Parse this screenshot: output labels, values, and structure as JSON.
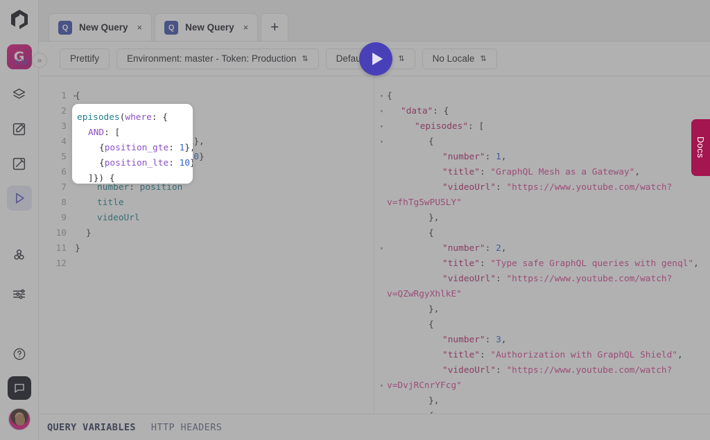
{
  "app": {
    "brand_logo_name": "hygraph-logo",
    "project_initial": "G",
    "project_label": "~CM"
  },
  "sidebar": {
    "collapse_icon": "»",
    "items": [
      {
        "name": "sidebar-item-schema",
        "icon": "layers-icon",
        "active": false
      },
      {
        "name": "sidebar-item-content",
        "icon": "edit-box-icon",
        "active": false
      },
      {
        "name": "sidebar-item-assets",
        "icon": "pencil-box-icon",
        "active": false
      },
      {
        "name": "sidebar-item-api-playground",
        "icon": "play-triangle-icon",
        "active": true
      },
      {
        "name": "sidebar-item-webhooks",
        "icon": "webhook-icon",
        "active": false
      },
      {
        "name": "sidebar-item-settings",
        "icon": "sliders-icon",
        "active": false
      }
    ],
    "help_icon": "question-circle-icon",
    "chat_icon": "chat-bubble-icon",
    "avatar_name": "user-avatar"
  },
  "tabs": {
    "items": [
      {
        "badge": "Q",
        "label": "New Query",
        "close": "×",
        "active": true
      },
      {
        "badge": "Q",
        "label": "New Query",
        "close": "×",
        "active": false
      }
    ],
    "add_label": "+"
  },
  "toolbar": {
    "prettify_label": "Prettify",
    "environment_label": "Environment: master - Token: Production",
    "environment_chevron": "⇅",
    "stage_label": "Default Stage",
    "stage_chevron": "⇅",
    "locale_label": "No Locale",
    "locale_chevron": "⇅",
    "run_button_name": "execute-query-button"
  },
  "editor": {
    "line_numbers": [
      "1",
      "2",
      "3",
      "4",
      "5",
      "6",
      "7",
      "8",
      "9",
      "10",
      "11",
      "12"
    ],
    "fold_lines": [
      1,
      2,
      6
    ],
    "fold_glyph": "▾",
    "lines": [
      {
        "indent": 0,
        "tokens": [
          {
            "t": "brace",
            "v": "{"
          }
        ]
      },
      {
        "indent": 1,
        "tokens": [
          {
            "t": "field",
            "v": "episodes"
          },
          {
            "t": "punct",
            "v": "("
          },
          {
            "t": "arg",
            "v": "where"
          },
          {
            "t": "punct",
            "v": ": {"
          }
        ]
      },
      {
        "indent": 2,
        "tokens": [
          {
            "t": "arg",
            "v": "AND"
          },
          {
            "t": "punct",
            "v": ": ["
          }
        ]
      },
      {
        "indent": 3,
        "tokens": [
          {
            "t": "punct",
            "v": "{"
          },
          {
            "t": "arg",
            "v": "position_gte"
          },
          {
            "t": "punct",
            "v": ": "
          },
          {
            "t": "num",
            "v": "1"
          },
          {
            "t": "punct",
            "v": "},"
          }
        ]
      },
      {
        "indent": 3,
        "tokens": [
          {
            "t": "punct",
            "v": "{"
          },
          {
            "t": "arg",
            "v": "position_lte"
          },
          {
            "t": "punct",
            "v": ": "
          },
          {
            "t": "num",
            "v": "10"
          },
          {
            "t": "punct",
            "v": "}"
          }
        ]
      },
      {
        "indent": 2,
        "tokens": [
          {
            "t": "punct",
            "v": "]}) {"
          }
        ]
      },
      {
        "indent": 2,
        "tokens": [
          {
            "t": "field",
            "v": "number"
          },
          {
            "t": "punct",
            "v": ": "
          },
          {
            "t": "field",
            "v": "position"
          }
        ]
      },
      {
        "indent": 2,
        "tokens": [
          {
            "t": "field",
            "v": "title"
          }
        ]
      },
      {
        "indent": 2,
        "tokens": [
          {
            "t": "field",
            "v": "videoUrl"
          }
        ]
      },
      {
        "indent": 1,
        "tokens": [
          {
            "t": "brace",
            "v": "}"
          }
        ]
      },
      {
        "indent": 0,
        "tokens": [
          {
            "t": "brace",
            "v": "}"
          }
        ]
      },
      {
        "indent": 0,
        "tokens": []
      }
    ]
  },
  "spotlight": {
    "lines": [
      {
        "indent": 0,
        "tokens": [
          {
            "t": "field",
            "v": "episodes"
          },
          {
            "t": "punct",
            "v": "("
          },
          {
            "t": "arg",
            "v": "where"
          },
          {
            "t": "punct",
            "v": ": {"
          }
        ]
      },
      {
        "indent": 1,
        "tokens": [
          {
            "t": "arg",
            "v": "AND"
          },
          {
            "t": "punct",
            "v": ": ["
          }
        ]
      },
      {
        "indent": 2,
        "tokens": [
          {
            "t": "punct",
            "v": "{"
          },
          {
            "t": "arg",
            "v": "position_gte"
          },
          {
            "t": "punct",
            "v": ": "
          },
          {
            "t": "num",
            "v": "1"
          },
          {
            "t": "punct",
            "v": "},"
          }
        ]
      },
      {
        "indent": 2,
        "tokens": [
          {
            "t": "punct",
            "v": "{"
          },
          {
            "t": "arg",
            "v": "position_lte"
          },
          {
            "t": "punct",
            "v": ": "
          },
          {
            "t": "num",
            "v": "10"
          },
          {
            "t": "punct",
            "v": "}"
          }
        ]
      },
      {
        "indent": 1,
        "tokens": [
          {
            "t": "punct",
            "v": "]}) {"
          }
        ]
      }
    ]
  },
  "result": {
    "fold_rows": [
      0,
      1,
      2,
      3,
      10,
      19
    ],
    "fold_glyph": "▾",
    "lines": [
      {
        "indent": 0,
        "tokens": [
          {
            "t": "brace",
            "v": "{"
          }
        ]
      },
      {
        "indent": 1,
        "tokens": [
          {
            "t": "key",
            "v": "\"data\""
          },
          {
            "t": "punct",
            "v": ": {"
          }
        ]
      },
      {
        "indent": 2,
        "tokens": [
          {
            "t": "key",
            "v": "\"episodes\""
          },
          {
            "t": "punct",
            "v": ": ["
          }
        ]
      },
      {
        "indent": 3,
        "tokens": [
          {
            "t": "punct",
            "v": "{"
          }
        ]
      },
      {
        "indent": 4,
        "tokens": [
          {
            "t": "key",
            "v": "\"number\""
          },
          {
            "t": "punct",
            "v": ": "
          },
          {
            "t": "num",
            "v": "1"
          },
          {
            "t": "punct",
            "v": ","
          }
        ]
      },
      {
        "indent": 4,
        "tokens": [
          {
            "t": "key",
            "v": "\"title\""
          },
          {
            "t": "punct",
            "v": ": "
          },
          {
            "t": "str",
            "v": "\"GraphQL Mesh as a Gateway\""
          },
          {
            "t": "punct",
            "v": ","
          }
        ]
      },
      {
        "indent": 4,
        "tokens": [
          {
            "t": "key",
            "v": "\"videoUrl\""
          },
          {
            "t": "punct",
            "v": ": "
          },
          {
            "t": "str",
            "v": "\"https://www.youtube.com/watch?"
          }
        ]
      },
      {
        "indent": -1,
        "tokens": [
          {
            "t": "str",
            "v": "v=fhTg5wPU5LY\""
          }
        ]
      },
      {
        "indent": 3,
        "tokens": [
          {
            "t": "punct",
            "v": "},"
          }
        ]
      },
      {
        "indent": 3,
        "tokens": [
          {
            "t": "punct",
            "v": "{"
          }
        ]
      },
      {
        "indent": 4,
        "tokens": [
          {
            "t": "key",
            "v": "\"number\""
          },
          {
            "t": "punct",
            "v": ": "
          },
          {
            "t": "num",
            "v": "2"
          },
          {
            "t": "punct",
            "v": ","
          }
        ]
      },
      {
        "indent": 4,
        "tokens": [
          {
            "t": "key",
            "v": "\"title\""
          },
          {
            "t": "punct",
            "v": ": "
          },
          {
            "t": "str",
            "v": "\"Type safe GraphQL queries with genql\""
          },
          {
            "t": "punct",
            "v": ","
          }
        ]
      },
      {
        "indent": 4,
        "tokens": [
          {
            "t": "key",
            "v": "\"videoUrl\""
          },
          {
            "t": "punct",
            "v": ": "
          },
          {
            "t": "str",
            "v": "\"https://www.youtube.com/watch?"
          }
        ]
      },
      {
        "indent": -1,
        "tokens": [
          {
            "t": "str",
            "v": "v=QZwRgyXhlkE\""
          }
        ]
      },
      {
        "indent": 3,
        "tokens": [
          {
            "t": "punct",
            "v": "},"
          }
        ]
      },
      {
        "indent": 3,
        "tokens": [
          {
            "t": "punct",
            "v": "{"
          }
        ]
      },
      {
        "indent": 4,
        "tokens": [
          {
            "t": "key",
            "v": "\"number\""
          },
          {
            "t": "punct",
            "v": ": "
          },
          {
            "t": "num",
            "v": "3"
          },
          {
            "t": "punct",
            "v": ","
          }
        ]
      },
      {
        "indent": 4,
        "tokens": [
          {
            "t": "key",
            "v": "\"title\""
          },
          {
            "t": "punct",
            "v": ": "
          },
          {
            "t": "str",
            "v": "\"Authorization with GraphQL Shield\""
          },
          {
            "t": "punct",
            "v": ","
          }
        ]
      },
      {
        "indent": 4,
        "tokens": [
          {
            "t": "key",
            "v": "\"videoUrl\""
          },
          {
            "t": "punct",
            "v": ": "
          },
          {
            "t": "str",
            "v": "\"https://www.youtube.com/watch?"
          }
        ]
      },
      {
        "indent": -1,
        "tokens": [
          {
            "t": "str",
            "v": "v=DvjRCnrYFcg\""
          }
        ]
      },
      {
        "indent": 3,
        "tokens": [
          {
            "t": "punct",
            "v": "},"
          }
        ]
      },
      {
        "indent": 3,
        "tokens": [
          {
            "t": "punct",
            "v": "{"
          }
        ]
      }
    ]
  },
  "docs": {
    "label": "Docs",
    "color": "#a31650"
  },
  "bottom": {
    "query_variables_label": "QUERY VARIABLES",
    "http_headers_label": "HTTP HEADERS"
  },
  "colors": {
    "accent_purple": "#4840b8",
    "brand_pink": "#e0117f",
    "tab_badge_blue": "#3b4fad",
    "docs_maroon": "#a31650"
  }
}
